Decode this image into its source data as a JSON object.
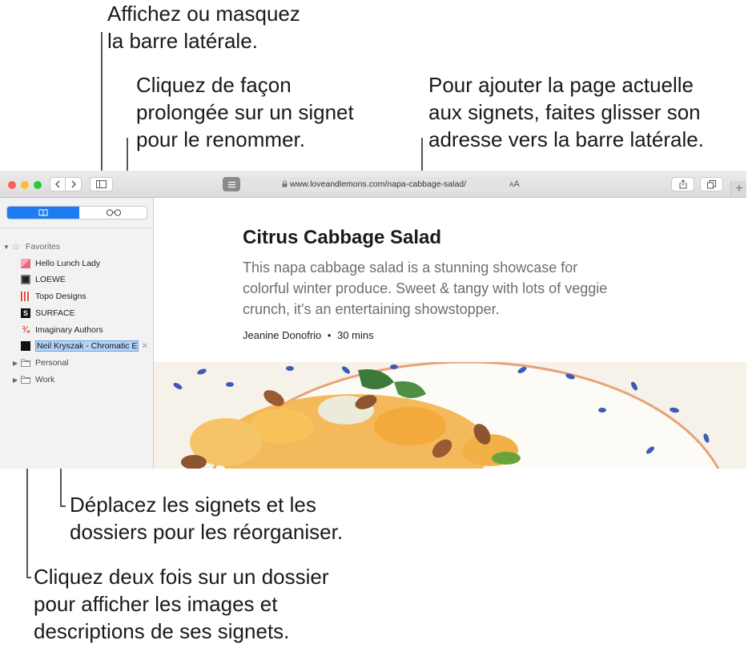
{
  "callouts": {
    "sidebar_toggle": "Affichez ou masquez\nla barre latérale.",
    "rename": "Cliquez de façon\nprolongée sur un signet\npour le renommer.",
    "add_page": "Pour ajouter la page actuelle\naux signets, faites glisser son\nadresse vers la barre latérale.",
    "move": "Déplacez les signets et les\ndossiers pour les réorganiser.",
    "double_click": "Cliquez deux fois sur un dossier\npour afficher les images et\ndescriptions de ses signets."
  },
  "toolbar": {
    "url": "www.loveandlemons.com/napa-cabbage-salad/",
    "text_size_label": "AA",
    "new_tab_label": "+",
    "icons": [
      "back-icon",
      "forward-icon",
      "sidebar-icon",
      "reader-icon",
      "lock-icon",
      "share-icon",
      "tabs-icon"
    ]
  },
  "sidebar": {
    "segments": [
      "bookmarks-icon",
      "reading-list-icon"
    ],
    "favorites_label": "Favorites",
    "bookmarks": [
      {
        "label": "Hello Lunch Lady",
        "icon": "hello-lunch-lady-favicon"
      },
      {
        "label": "LOEWE",
        "icon": "loewe-favicon"
      },
      {
        "label": "Topo Designs",
        "icon": "topo-designs-favicon"
      },
      {
        "label": "SURFACE",
        "icon": "surface-favicon"
      },
      {
        "label": "Imaginary Authors",
        "icon": "imaginary-authors-favicon"
      }
    ],
    "editing_bookmark": "Neil Kryszak - Chromatic E",
    "folders": [
      "Personal",
      "Work"
    ]
  },
  "article": {
    "title": "Citrus Cabbage Salad",
    "description": "This napa cabbage salad is a stunning showcase for colorful winter produce. Sweet & tangy with lots of veggie crunch, it's an entertaining showstopper.",
    "author": "Jeanine Donofrio",
    "separator": "•",
    "time": "30 mins"
  },
  "colors": {
    "accent": "#1f7bf2",
    "selection": "#b3d3f7",
    "close": "#fd5f57",
    "minimize": "#febc2e",
    "zoom": "#28c840"
  }
}
